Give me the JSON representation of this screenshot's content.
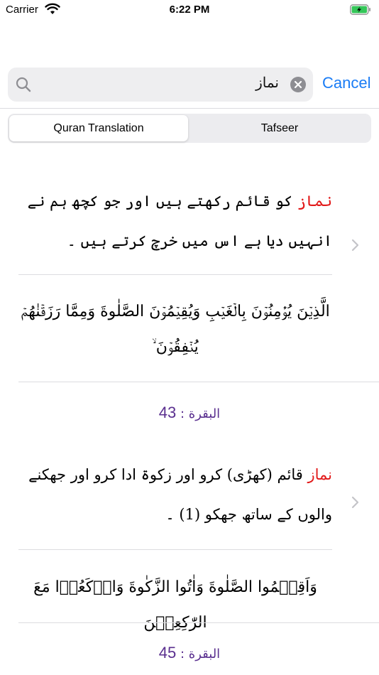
{
  "status_bar": {
    "carrier": "Carrier",
    "time": "6:22 PM"
  },
  "search": {
    "value": "نماز",
    "cancel_label": "Cancel"
  },
  "tabs": [
    {
      "label": "Quran Translation",
      "selected": true
    },
    {
      "label": "Tafseer",
      "selected": false
    }
  ],
  "results": [
    {
      "highlight": "نماز",
      "translation_rest": " کو قائم رکھتے ہیں اور جو کچھ ہم نے انہیں دیا ہے اس میں خرچ کرتے ہیں ۔",
      "arabic": "الَّذِيۡنَ يُؤۡمِنُوۡنَ بِالۡغَيۡبِ وَيُقِيۡمُوۡنَ الصَّلٰوةَ وَمِمَّا رَزَقۡنٰهُمۡ يُنۡفِقُوۡنَ ۙ",
      "surah": "البقرة",
      "ayah": "43"
    },
    {
      "highlight": "نماز",
      "translation_rest": " قائم (کھڑی) کرو اور زکوۃ ادا کرو اور جھکنے والوں کے ساتھ جھکو (1) ۔",
      "arabic": "وَاَقِيۡمُوا الصَّلٰوةَ وَاٰتُوا الزَّکٰوةَ وَارۡكَعُوۡا مَعَ الرّٰكِعِيۡنَ",
      "surah": "البقرة",
      "ayah": "45"
    }
  ],
  "colors": {
    "accent": "#1a7cf5",
    "highlight": "#e21919",
    "reference": "#5a2f8f"
  }
}
